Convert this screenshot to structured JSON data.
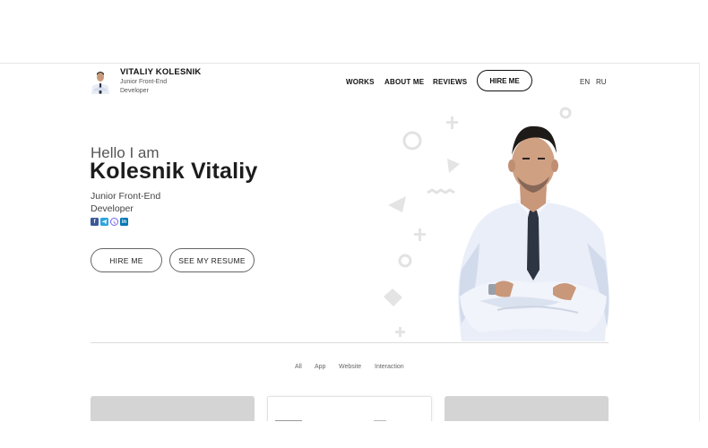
{
  "header": {
    "brand_name": "VITALIY KOLESNIK",
    "brand_subtitle": "Junior Front-End Developer",
    "nav": [
      "WORKS",
      "ABOUT ME",
      "REVIEWS"
    ],
    "hire_button": "HIRE ME",
    "languages": [
      "EN",
      "RU"
    ]
  },
  "hero": {
    "greeting": "Hello I am",
    "name": "Kolesnik Vitaliy",
    "role": "Junior Front-End Developer",
    "socials": [
      {
        "icon": "facebook-icon",
        "color": "#3b5998"
      },
      {
        "icon": "telegram-icon",
        "color": "#2ca5e0"
      },
      {
        "icon": "viber-icon",
        "color": "#7360f2"
      },
      {
        "icon": "linkedin-icon",
        "color": "#0077b5"
      }
    ],
    "primary_button": "HIRE ME",
    "secondary_button": "SEE MY RESUME"
  },
  "portfolio": {
    "filters": [
      "All",
      "App",
      "Website",
      "Interaction"
    ]
  },
  "colors": {
    "text_dark": "#1c1c1c",
    "decor_grey": "#e4e4e4",
    "card_grey": "#d4d4d4"
  }
}
